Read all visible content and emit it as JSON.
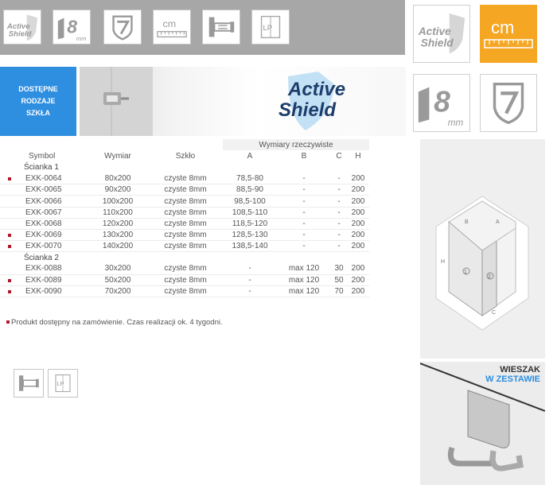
{
  "colors": {
    "top_bar": "#a7a7a7",
    "accent_blue": "#2e8ee0",
    "accent_orange": "#f5a623",
    "marker_red": "#b0182b"
  },
  "icons": {
    "active_shield": {
      "line1": "Active",
      "line2": "Shield"
    },
    "glass_thickness": {
      "value": "8",
      "unit": "mm"
    },
    "unit_badge": "cm",
    "lp_badge": "LP"
  },
  "banner": {
    "availability": "DOSTĘPNE RODZAJE SZKŁA",
    "brand_line1": "Active",
    "brand_line2": "Shield"
  },
  "table": {
    "group_header": "Wymiary rzeczywiste",
    "headers": {
      "symbol": "Symbol",
      "wymiar": "Wymiar",
      "szklo": "Szkło",
      "a": "A",
      "b": "B",
      "c": "C",
      "h": "H"
    },
    "section1": "Ścianka 1",
    "section2": "Ścianka 2",
    "rows1": [
      {
        "symbol": "EXK-0064",
        "wymiar": "80x200",
        "szklo": "czyste 8mm",
        "a": "78,5-80",
        "b": "-",
        "c": "-",
        "h": "200",
        "marked": true
      },
      {
        "symbol": "EXK-0065",
        "wymiar": "90x200",
        "szklo": "czyste 8mm",
        "a": "88,5-90",
        "b": "-",
        "c": "-",
        "h": "200",
        "marked": false
      },
      {
        "symbol": "EXK-0066",
        "wymiar": "100x200",
        "szklo": "czyste 8mm",
        "a": "98,5-100",
        "b": "-",
        "c": "-",
        "h": "200",
        "marked": false
      },
      {
        "symbol": "EXK-0067",
        "wymiar": "110x200",
        "szklo": "czyste 8mm",
        "a": "108,5-110",
        "b": "-",
        "c": "-",
        "h": "200",
        "marked": false
      },
      {
        "symbol": "EXK-0068",
        "wymiar": "120x200",
        "szklo": "czyste 8mm",
        "a": "118,5-120",
        "b": "-",
        "c": "-",
        "h": "200",
        "marked": false
      },
      {
        "symbol": "EXK-0069",
        "wymiar": "130x200",
        "szklo": "czyste 8mm",
        "a": "128,5-130",
        "b": "-",
        "c": "-",
        "h": "200",
        "marked": true
      },
      {
        "symbol": "EXK-0070",
        "wymiar": "140x200",
        "szklo": "czyste 8mm",
        "a": "138,5-140",
        "b": "-",
        "c": "-",
        "h": "200",
        "marked": true
      }
    ],
    "rows2": [
      {
        "symbol": "EXK-0088",
        "wymiar": "30x200",
        "szklo": "czyste 8mm",
        "a": "-",
        "b": "max 120",
        "c": "30",
        "h": "200",
        "marked": false
      },
      {
        "symbol": "EXK-0089",
        "wymiar": "50x200",
        "szklo": "czyste 8mm",
        "a": "-",
        "b": "max 120",
        "c": "50",
        "h": "200",
        "marked": true
      },
      {
        "symbol": "EXK-0090",
        "wymiar": "70x200",
        "szklo": "czyste 8mm",
        "a": "-",
        "b": "max 120",
        "c": "70",
        "h": "200",
        "marked": true
      }
    ]
  },
  "footnote": "Produkt dostępny na zamówienie. Czas realizacji ok. 4 tygodni.",
  "diagram": {
    "labels": {
      "a": "A",
      "b": "B",
      "c": "C",
      "h": "H",
      "p1": "1",
      "p2": "2"
    }
  },
  "hanger": {
    "line1": "WIESZAK",
    "line2": "W ZESTAWIE"
  }
}
